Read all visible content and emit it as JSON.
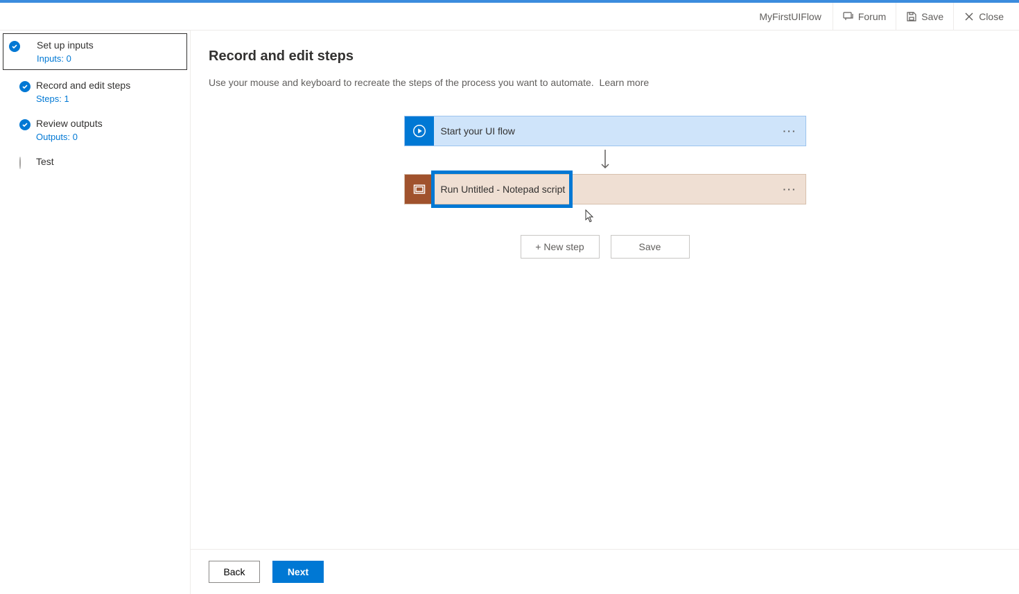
{
  "header": {
    "flow_name": "MyFirstUIFlow",
    "forum": "Forum",
    "save": "Save",
    "close": "Close"
  },
  "sidebar": {
    "steps": [
      {
        "label": "Set up inputs",
        "sub": "Inputs: 0",
        "done": true,
        "selected": true
      },
      {
        "label": "Record and edit steps",
        "sub": "Steps: 1",
        "done": true,
        "selected": false
      },
      {
        "label": "Review outputs",
        "sub": "Outputs: 0",
        "done": true,
        "selected": false
      },
      {
        "label": "Test",
        "sub": "",
        "done": false,
        "selected": false
      }
    ]
  },
  "main": {
    "title": "Record and edit steps",
    "description": "Use your mouse and keyboard to recreate the steps of the process you want to automate.",
    "learn_more": "Learn more",
    "cards": {
      "start": "Start your UI flow",
      "run": "Run Untitled - Notepad script"
    },
    "actions": {
      "new_step": "+ New step",
      "save": "Save"
    }
  },
  "footer": {
    "back": "Back",
    "next": "Next"
  }
}
